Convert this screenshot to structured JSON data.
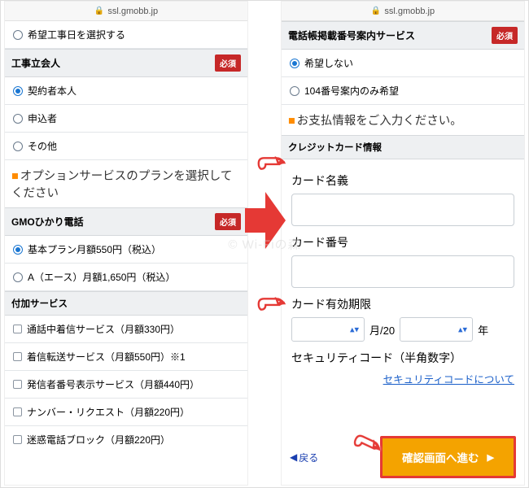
{
  "domain": "ssl.gmobb.jp",
  "left": {
    "kibou_kouji": "希望工事日を選択する",
    "tachiai_head": "工事立会人",
    "required": "必須",
    "tachiai_opts": [
      "契約者本人",
      "申込者",
      "その他"
    ],
    "option_title": "オプションサービスのプランを選択してください",
    "hikari_head": "GMOひかり電話",
    "hikari_opts": [
      "基本プラン月額550円（税込）",
      "A（エース）月額1,650円（税込）"
    ],
    "fuka_head": "付加サービス",
    "fuka_opts": [
      "通話中着信サービス（月額330円）",
      "着信転送サービス（月額550円）※1",
      "発信者番号表示サービス（月額440円）",
      "ナンバー・リクエスト（月額220円）",
      "迷惑電話ブロック（月額220円）"
    ]
  },
  "right": {
    "denwa_head": "電話帳掲載番号案内サービス",
    "required": "必須",
    "denwa_opts": [
      "希望しない",
      "104番号案内のみ希望"
    ],
    "pay_title": "お支払情報をご入力ください。",
    "cc_head": "クレジットカード情報",
    "card_name_label": "カード名義",
    "card_no_label": "カード番号",
    "exp_label": "カード有効期限",
    "exp_month_sep": "月/20",
    "exp_year_suffix": "年",
    "sec_label": "セキュリティコード（半角数字）",
    "sec_link": "セキュリティコードについて",
    "back": "戻る",
    "proceed": "確認画面へ進む"
  },
  "watermark": "© Wi-Fiの森"
}
